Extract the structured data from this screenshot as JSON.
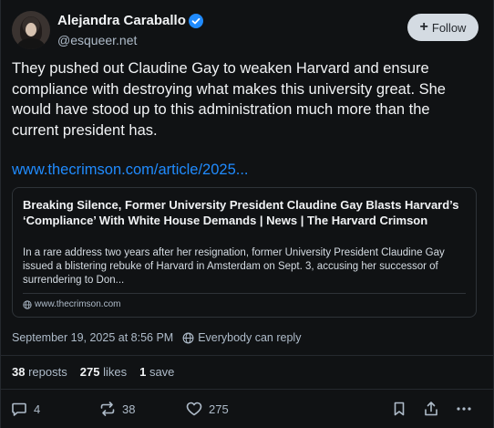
{
  "author": {
    "display_name": "Alejandra Caraballo",
    "handle": "@esqueer.net",
    "verified_icon": "verified-check-icon",
    "verified_color": "#208bfe"
  },
  "follow_button": {
    "label": "Follow",
    "icon": "plus-icon"
  },
  "post": {
    "text": "They pushed out Claudine Gay to weaken Harvard and ensure compliance with destroying what makes this university great. She would have stood up to this administration much more than the current president has.",
    "link_text": "www.thecrimson.com/article/2025..."
  },
  "link_card": {
    "title": "Breaking Silence, Former University President Claudine Gay Blasts Harvard’s ‘Compliance’ With White House Demands | News | The Harvard Crimson",
    "description": "In a rare address two years after her resignation, former University President Claudine Gay issued a blistering rebuke of Harvard in Amsterdam on Sept. 3, accusing her successor of surrendering to Don...",
    "domain_icon": "globe-icon",
    "domain": "www.thecrimson.com"
  },
  "meta": {
    "timestamp": "September 19, 2025 at 8:56 PM",
    "reply_setting_icon": "globe-icon",
    "reply_setting": "Everybody can reply"
  },
  "stats": {
    "reposts_count": "38",
    "reposts_label": "reposts",
    "likes_count": "275",
    "likes_label": "likes",
    "saves_count": "1",
    "saves_label": "save"
  },
  "actions": {
    "reply_count": "4",
    "repost_count": "38",
    "like_count": "275"
  },
  "colors": {
    "background": "#101214",
    "text": "#f1f3f5",
    "muted": "#aebbc9",
    "link": "#208bfe",
    "border": "#2e3338",
    "follow_bg": "#d4dbe2"
  }
}
